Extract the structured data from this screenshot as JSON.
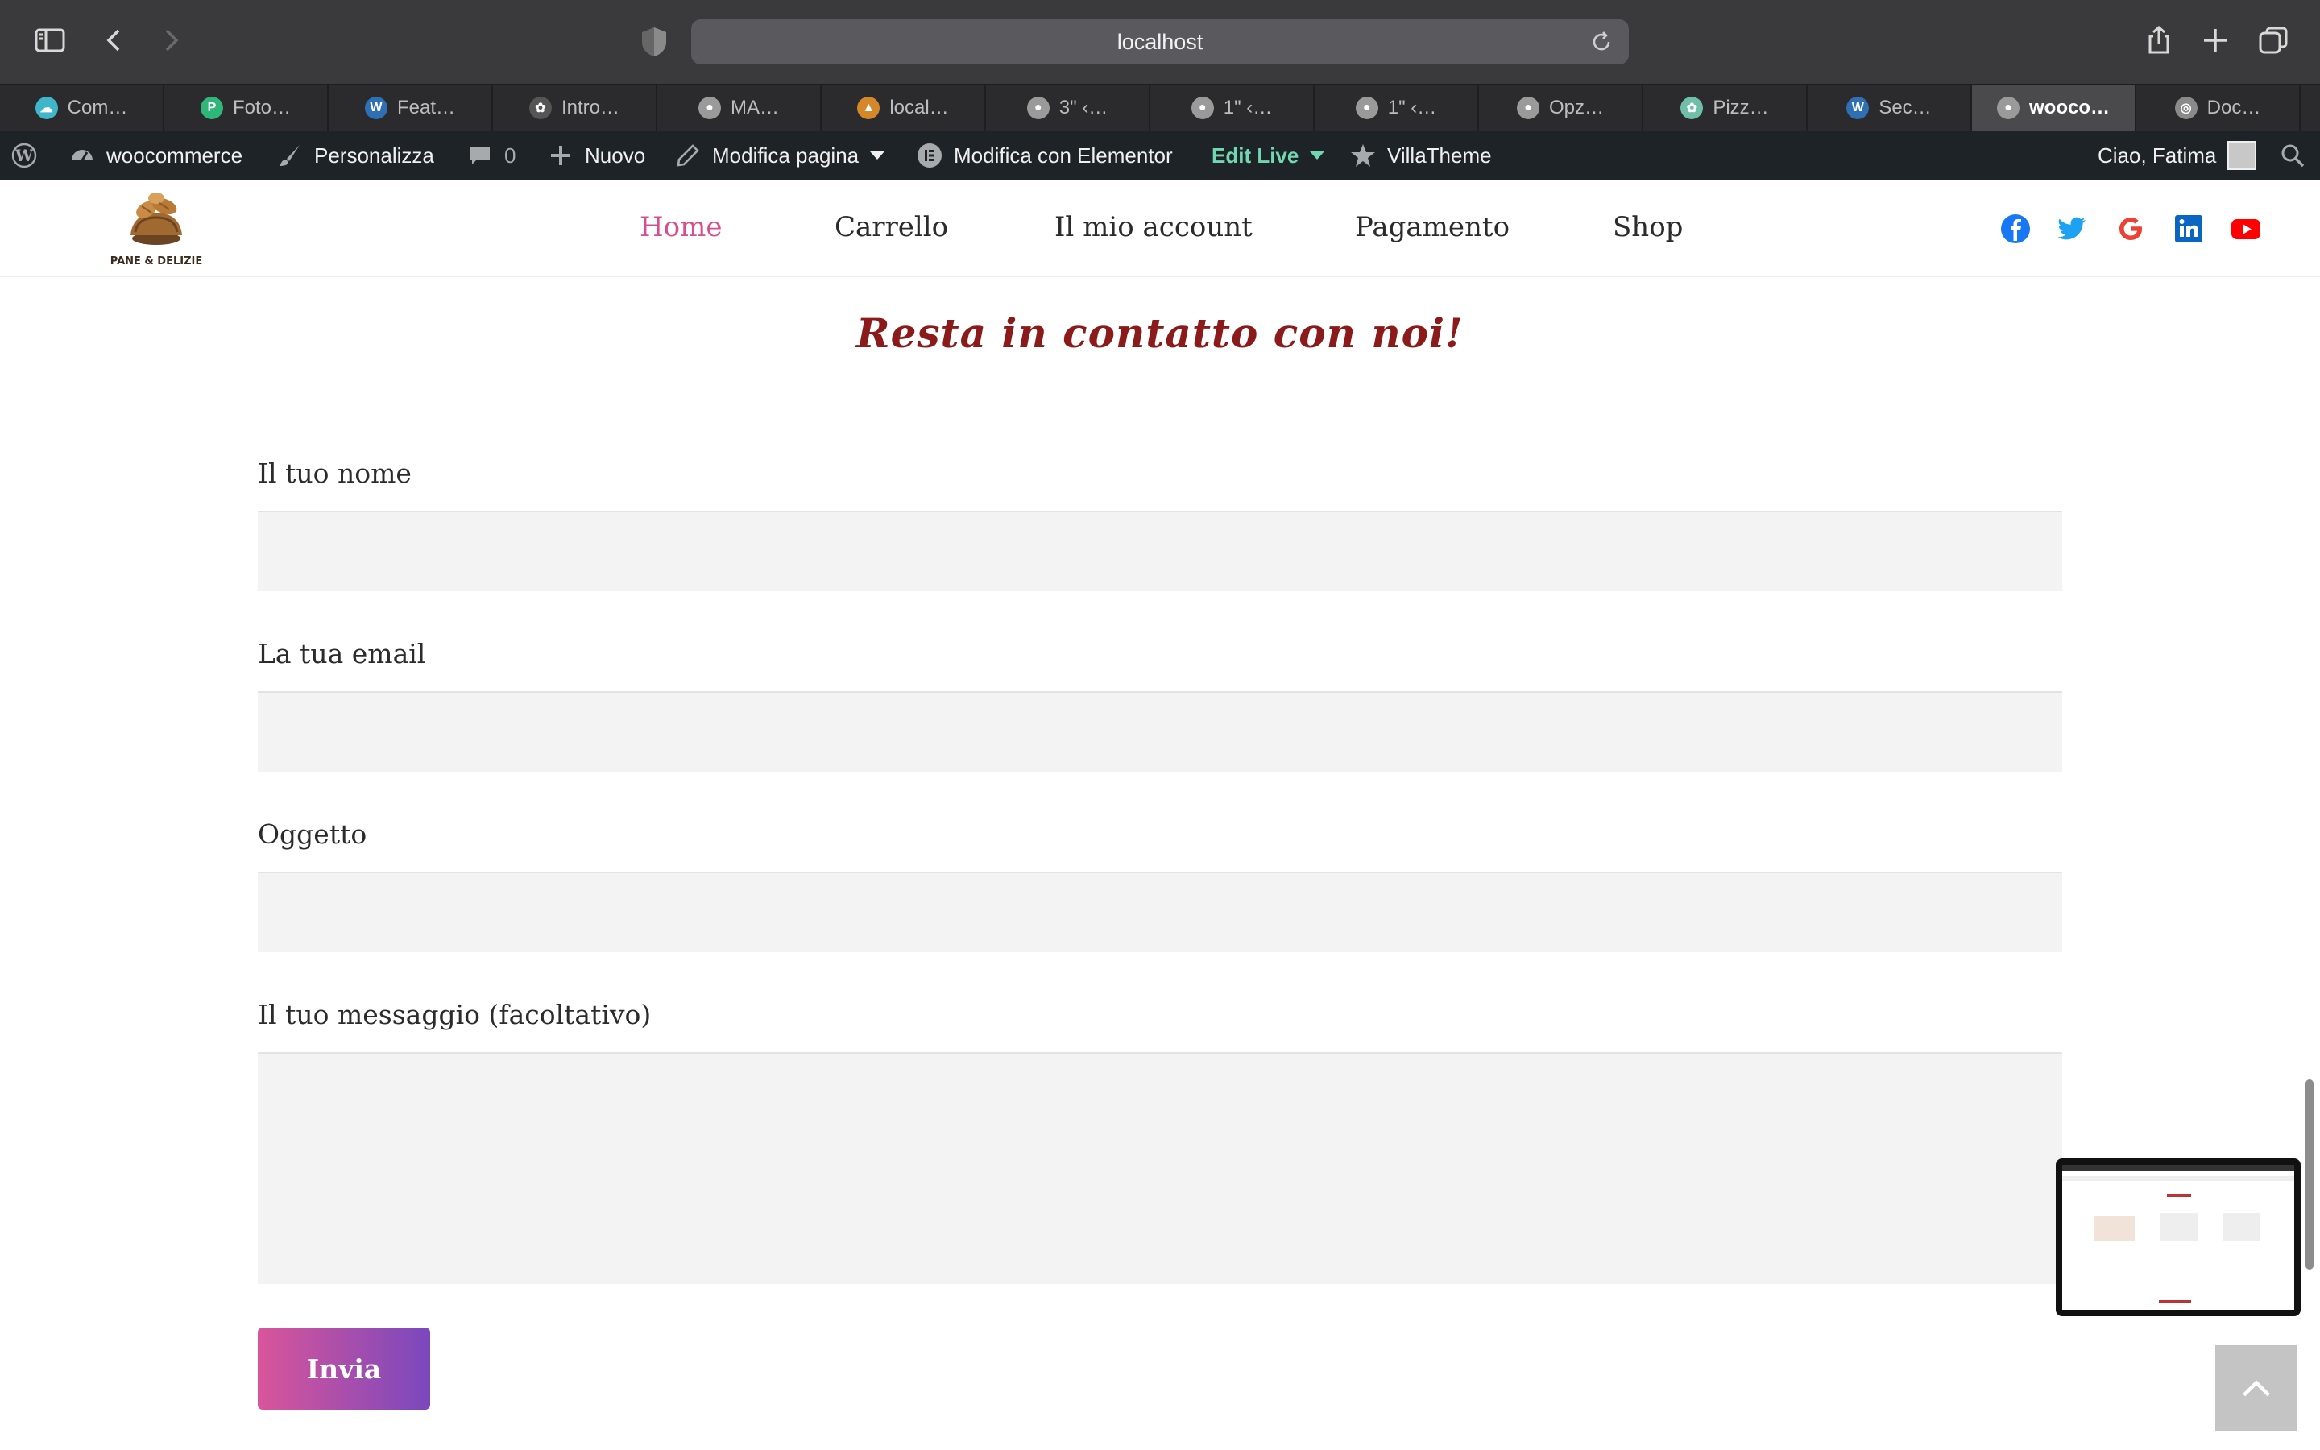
{
  "browser": {
    "address": "localhost",
    "tabs": [
      {
        "label": "Com…",
        "icon": "cloud-icon",
        "color": "#3fb6c9"
      },
      {
        "label": "Foto…",
        "icon": "p-logo-icon",
        "color": "#2fb77a"
      },
      {
        "label": "Feat…",
        "icon": "wordpress-icon",
        "color": "#2f6fb3"
      },
      {
        "label": "Intro…",
        "icon": "openai-icon",
        "color": "#555555"
      },
      {
        "label": "MA…",
        "icon": "mastodon-icon",
        "color": "#9a9a9a"
      },
      {
        "label": "local…",
        "icon": "mountain-icon",
        "color": "#d4882a"
      },
      {
        "label": "3\" ‹…",
        "icon": "mastodon-icon",
        "color": "#9a9a9a"
      },
      {
        "label": "1\" ‹…",
        "icon": "mastodon-icon",
        "color": "#9a9a9a"
      },
      {
        "label": "1\" ‹…",
        "icon": "mastodon-icon",
        "color": "#9a9a9a"
      },
      {
        "label": "Opz…",
        "icon": "mastodon-icon",
        "color": "#9a9a9a"
      },
      {
        "label": "Pizz…",
        "icon": "chatgpt-icon",
        "color": "#6fbfa8"
      },
      {
        "label": "Sec…",
        "icon": "wordpress-icon",
        "color": "#2f6fb3"
      },
      {
        "label": "wooco…",
        "icon": "mastodon-icon",
        "color": "#9a9a9a"
      },
      {
        "label": "Doc…",
        "icon": "compass-icon",
        "color": "#8a8a8a"
      }
    ],
    "active_tab": 12
  },
  "adminbar": {
    "site": "woocommerce",
    "customize": "Personalizza",
    "comments": "0",
    "new": "Nuovo",
    "edit_page": "Modifica pagina",
    "elementor": "Modifica con Elementor",
    "edit_live": "Edit Live",
    "villatheme": "VillaTheme",
    "greeting": "Ciao, Fatima"
  },
  "site": {
    "logo_text": "PANE & DELIZIE",
    "nav": [
      "Home",
      "Carrello",
      "Il mio account",
      "Pagamento",
      "Shop"
    ],
    "active_nav": "Home",
    "social": [
      "facebook-icon",
      "twitter-icon",
      "google-icon",
      "linkedin-icon",
      "youtube-icon"
    ]
  },
  "form": {
    "heading": "Resta in contatto con noi!",
    "name_label": "Il tuo nome",
    "email_label": "La tua email",
    "subject_label": "Oggetto",
    "message_label": "Il tuo messaggio (facoltativo)",
    "submit": "Invia"
  },
  "colors": {
    "accent_pink": "#d64f8c",
    "heading_red": "#8b1a1a",
    "button_start": "#d9559a",
    "button_end": "#7a48bd",
    "adminbar": "#1d2327",
    "edit_live": "#72d6b0"
  }
}
